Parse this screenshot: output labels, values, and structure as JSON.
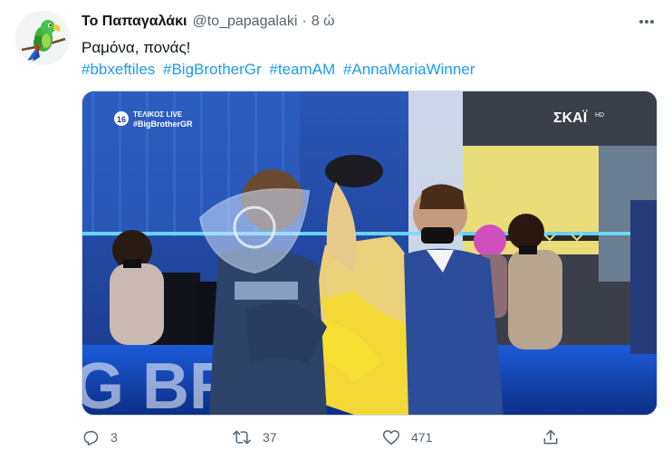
{
  "tweet": {
    "display_name": "Το Παπαγαλάκι",
    "handle": "@to_papagalaki",
    "separator": "·",
    "time": "8 ώ",
    "text": "Ραμόνα, πονάς!",
    "hashtags": [
      "#bbxeftiles",
      "#BigBrotherGr",
      "#teamAM",
      "#AnnaMariaWinner"
    ]
  },
  "media": {
    "channel_badge": "ΤΕΛΙΚΟΣ LIVE",
    "channel_tag": "#BigBrotherGR",
    "channel_number": "16",
    "network_logo": "ΣΚΑΪ",
    "network_suffix": "HD",
    "stage_letters": "G BR     R"
  },
  "actions": {
    "replies": "3",
    "retweets": "37",
    "likes": "471"
  },
  "colors": {
    "link": "#1d9bf0",
    "secondary": "#536471",
    "stage_blue": "#1b3f90"
  },
  "icons": {
    "avatar": "parrot-avatar",
    "more": "more-horizontal-icon",
    "reply": "reply-icon",
    "retweet": "retweet-icon",
    "like": "like-icon",
    "share": "share-icon"
  }
}
